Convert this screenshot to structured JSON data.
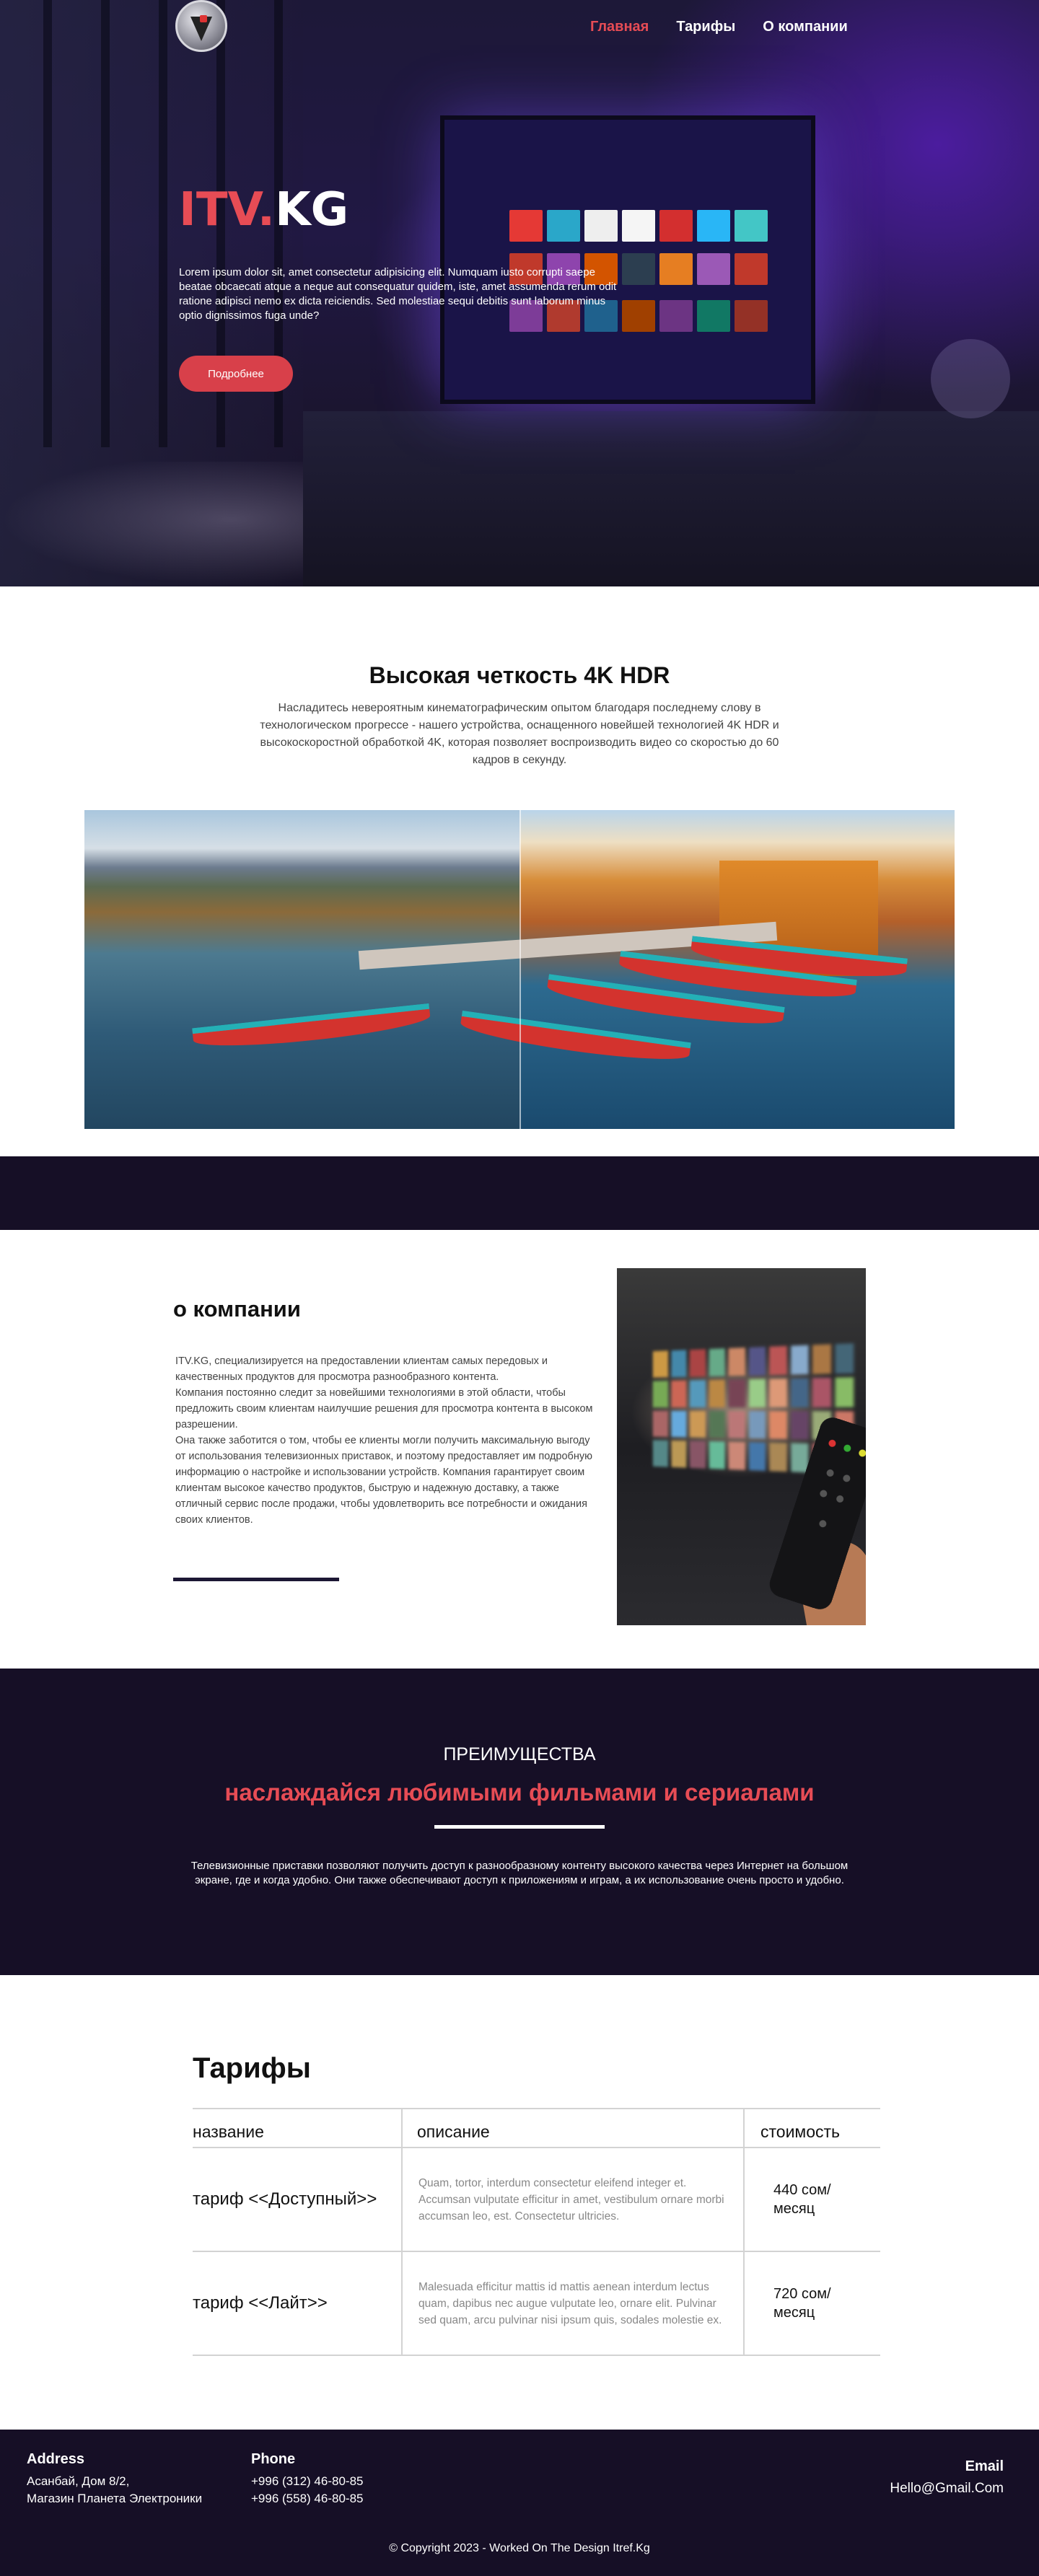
{
  "nav": {
    "items": [
      "Главная",
      "Тарифы",
      "О компании"
    ]
  },
  "hero": {
    "brand_part1": "ITV.",
    "brand_part2": "KG",
    "text": "Lorem ipsum dolor sit, amet consectetur adipisicing elit. Numquam iusto corrupti saepe beatae obcaecati atque a neque aut consequatur quidem, iste, amet assumenda rerum odit ratione adipisci nemo ex dicta reiciendis. Sed molestiae sequi debitis sunt laborum minus optio dignissimos fuga unde?",
    "button": "Подробнее"
  },
  "quality": {
    "title": "Высокая четкость 4K HDR",
    "text": "Насладитесь невероятным кинематографическим опытом благодаря последнему слову в технологическом прогрессе - нашего устройства, оснащенного новейшей технологией 4K HDR и высокоскоростной обработкой 4K, которая позволяет воспроизводить видео со скоростью до 60 кадров в секунду."
  },
  "about": {
    "title": "о компании",
    "text": "ITV.KG, специализируется на предоставлении клиентам самых передовых и качественных продуктов для просмотра разнообразного контента.\nКомпания постоянно следит за новейшими технологиями в этой области, чтобы предложить своим клиентам наилучшие решения для просмотра контента в высоком разрешении.\nОна также заботится о том, чтобы ее клиенты могли получить максимальную выгоду от использования телевизионных приставок, и поэтому предоставляет им подробную информацию о настройке и использовании устройств. Компания гарантирует своим клиентам высокое качество продуктов, быструю и надежную доставку, а также отличный сервис после продажи, чтобы удовлетворить все потребности и ожидания своих клиентов."
  },
  "advantages": {
    "label": "ПРЕИМУЩЕСТВА",
    "title": "наслаждайся любимыми фильмами и сериалами",
    "text": "Телевизионные приставки позволяют получить доступ к разнообразному контенту высокого качества через Интернет на большом экране, где и когда удобно. Они также обеспечивают доступ к приложениям и играм, а их использование очень просто и удобно."
  },
  "tariffs": {
    "title": "Тарифы",
    "headers": [
      "название",
      "описание",
      "стоимость"
    ],
    "rows": [
      {
        "name": "тариф <<Доступный>>",
        "description": "Quam, tortor, interdum consectetur eleifend integer et. Accumsan vulputate efficitur in amet, vestibulum ornare morbi accumsan leo, est. Consectetur ultricies.",
        "price_line1": "440 сом/",
        "price_line2": "месяц"
      },
      {
        "name": "тариф <<Лайт>>",
        "description": "Malesuada efficitur mattis id mattis aenean interdum lectus quam, dapibus nec augue vulputate leo, ornare elit. Pulvinar sed quam, arcu pulvinar nisi ipsum quis, sodales molestie ex.",
        "price_line1": "720 сом/",
        "price_line2": "месяц"
      }
    ]
  },
  "footer": {
    "address_title": "Address",
    "address_line1": "Асанбай, Дом 8/2,",
    "address_line2": "Магазин Планета Электроники",
    "phone_title": "Phone",
    "phone1": "+996 (312) 46-80-85",
    "phone2": "+996 (558) 46-80-85",
    "email_title": "Email",
    "email": "Hello@Gmail.Com",
    "copyright": "© Copyright 2023   -   Worked On The Design Itref.Kg"
  },
  "colors": {
    "accent": "#e74c55",
    "dark": "#160f26"
  }
}
